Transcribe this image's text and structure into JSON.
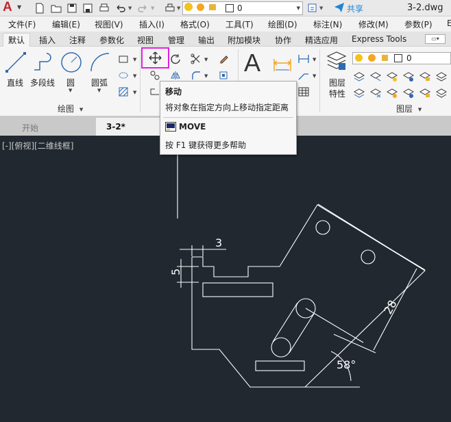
{
  "titlebar": {
    "app_letter": "A",
    "layer_value": "0",
    "share_label": "共享",
    "file_name": "3-2.dwg"
  },
  "menu": [
    "文件(F)",
    "编辑(E)",
    "视图(V)",
    "插入(I)",
    "格式(O)",
    "工具(T)",
    "绘图(D)",
    "标注(N)",
    "修改(M)",
    "参数(P)",
    "E"
  ],
  "ribbon_tabs": [
    "默认",
    "插入",
    "注释",
    "参数化",
    "视图",
    "管理",
    "输出",
    "附加模块",
    "协作",
    "精选应用",
    "Express Tools"
  ],
  "active_tab": "默认",
  "draw_panel": {
    "line": "直线",
    "polyline": "多段线",
    "circle": "圆",
    "arc": "圆弧",
    "title": "绘图"
  },
  "layer_panel": {
    "props_line1": "图层",
    "props_line2": "特性",
    "title": "图层",
    "layer_value": "0"
  },
  "tooltip": {
    "title": "移动",
    "description": "将对象在指定方向上移动指定距离",
    "command": "MOVE",
    "help": "按 F1 键获得更多帮助"
  },
  "doc_tabs": [
    "开始",
    "3-2*"
  ],
  "viewport_label": "[-][俯视][二维线框]",
  "drawing": {
    "dim_3": "3",
    "dim_5": "5",
    "dim_28": "28",
    "angle_58": "58°"
  },
  "colors": {
    "accent_red": "#c1272d",
    "highlight_magenta": "#e020e0",
    "canvas_bg": "#212830",
    "share_blue": "#1d84d6"
  }
}
